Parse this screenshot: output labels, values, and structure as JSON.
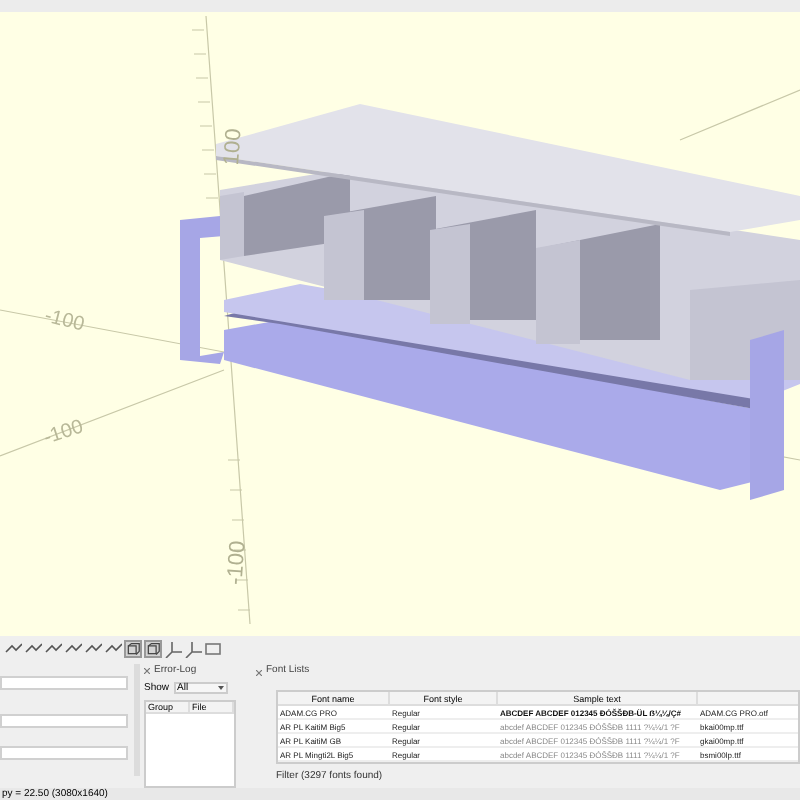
{
  "viewport": {
    "axis_labels": [
      {
        "text": "100",
        "kind": "vertical"
      },
      {
        "text": "-100",
        "kind": "diagonal"
      },
      {
        "text": "-100",
        "kind": "diagonal"
      },
      {
        "text": "-100",
        "kind": "vertical"
      }
    ]
  },
  "toolbar": {
    "buttons": [
      {
        "kind": "view",
        "selected": false
      },
      {
        "kind": "view",
        "selected": false
      },
      {
        "kind": "view",
        "selected": false
      },
      {
        "kind": "view",
        "selected": false
      },
      {
        "kind": "view",
        "selected": false
      },
      {
        "kind": "view",
        "selected": false
      },
      {
        "kind": "box",
        "selected": true
      },
      {
        "kind": "box",
        "selected": true
      },
      {
        "kind": "axes",
        "selected": false
      },
      {
        "kind": "axes",
        "selected": false
      },
      {
        "kind": "frame",
        "selected": false
      }
    ]
  },
  "error_log": {
    "title": "Error-Log",
    "show_label": "Show",
    "show_value": "All",
    "columns": [
      "Group",
      "File"
    ]
  },
  "font_list": {
    "title": "Font Lists",
    "columns": [
      "Font name",
      "Font style",
      "Sample text"
    ],
    "rows": [
      {
        "name": "ADAM.CG PRO",
        "style": "Regular",
        "sample": "ABCDEF ABCDEF 012345 ĐÓŠŠÐB-ÜL ẞ¼¼/Ç#",
        "file": "ADAM.CG PRO.otf"
      },
      {
        "name": "AR PL KaitiM Big5",
        "style": "Regular",
        "sample": "abcdef ABCDEF 012345 ĐÓŠŠÐB 1111 ?¼¼/1 ?F",
        "file": "bkai00mp.ttf"
      },
      {
        "name": "AR PL KaitiM GB",
        "style": "Regular",
        "sample": "abcdef ABCDEF 012345 ĐÓŠŠÐB 1111 ?¼¼/1 ?F",
        "file": "gkai00mp.ttf"
      },
      {
        "name": "AR PL Mingti2L Big5",
        "style": "Regular",
        "sample": "abcdef ABCDEF 012345 ĐÓŠŠÐB 1111 ?¼¼/1 ?F",
        "file": "bsmi00lp.ttf"
      }
    ],
    "filter": "Filter (3297 fonts found)"
  },
  "status_bar": {
    "text": "py = 22.50 (3080x1640)"
  }
}
